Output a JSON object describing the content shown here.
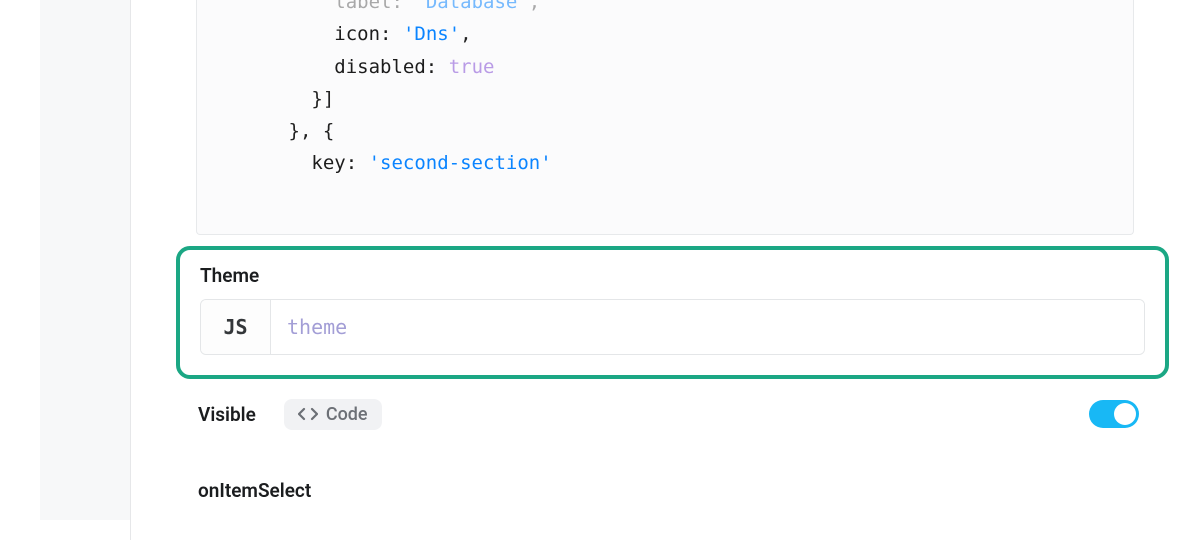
{
  "code": {
    "line1_label": "label:",
    "line1_str": "'Database'",
    "line1_end": ",",
    "line2_key": "icon:",
    "line2_str": "'Dns'",
    "line2_end": ",",
    "line3_key": "disabled:",
    "line3_bool": "true",
    "line4": "}]",
    "line5": "}, {",
    "line6_key": "key:",
    "line6_str": "'second-section'"
  },
  "theme": {
    "label": "Theme",
    "badge": "JS",
    "placeholder": "theme",
    "value": ""
  },
  "visible": {
    "label": "Visible",
    "code_pill": "Code",
    "toggled": true
  },
  "onItemSelect": {
    "label": "onItemSelect"
  }
}
